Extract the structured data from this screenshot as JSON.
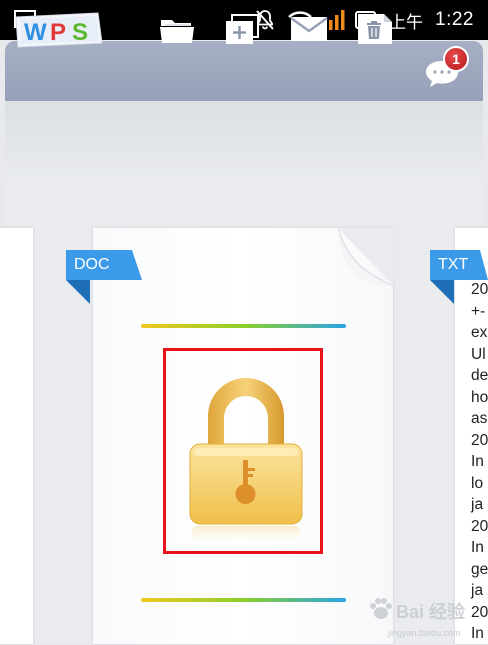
{
  "status_bar": {
    "ampm": "上午",
    "time": "1:22",
    "icons": [
      "image-icon",
      "mute-icon",
      "wifi-icon",
      "signal-icon",
      "battery-icon"
    ]
  },
  "toolbar": {
    "logo_text": "WPS",
    "buttons": [
      "open-folder",
      "new-document",
      "send-email",
      "delete"
    ],
    "notification_count": "1"
  },
  "documents": {
    "left_tag": "DOC",
    "right_tag": "TXT",
    "txt_preview_lines": [
      "20",
      "+-",
      "ex",
      "Ul",
      "de",
      "ho",
      "as",
      "20",
      "In",
      "lo",
      "ja",
      "20",
      "In",
      "ge",
      "ja",
      "20",
      "In"
    ]
  },
  "watermark": {
    "text": "Bai 经验",
    "sub": "jingyan.baidu.com"
  },
  "colors": {
    "toolbar": "#9ea8bf",
    "tag_blue": "#3b9be8",
    "highlight_red": "#e8121a",
    "lock_gold": "#f2c24a"
  }
}
